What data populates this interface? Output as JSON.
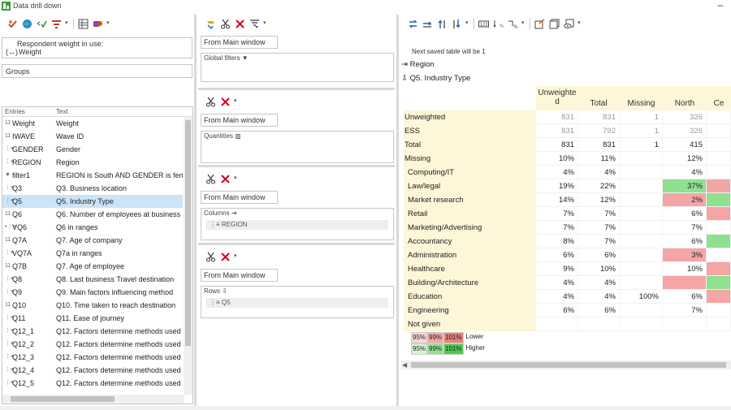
{
  "window": {
    "title": "Data drill down",
    "minimize_glyph": "–"
  },
  "left": {
    "weight_label": "Respondent weight in use:",
    "weight_value": "Weight",
    "weight_prefix": "(↔)",
    "groups_label": "Groups",
    "list_headers": {
      "entries": "Entries",
      "text": "Text"
    },
    "rows": [
      {
        "icon": "11",
        "entry": "Weight",
        "text": "Weight",
        "selected": false
      },
      {
        "icon": "11",
        "entry": "IWAVE",
        "text": "Wave ID",
        "selected": false
      },
      {
        "icon": "⋮≡",
        "entry": "GENDER",
        "text": "Gender",
        "selected": false
      },
      {
        "icon": "⋮≡",
        "entry": "REGION",
        "text": "Region",
        "selected": false
      },
      {
        "icon": "▼",
        "entry": "filter1",
        "text": "REGION is South AND GENDER is fem",
        "selected": false
      },
      {
        "icon": "⋮≡",
        "entry": "Q3",
        "text": "Q3. Business location",
        "selected": false
      },
      {
        "icon": "⋮≡",
        "entry": "Q5",
        "text": "Q5. Industry Type",
        "selected": true
      },
      {
        "icon": "11",
        "entry": "Q6",
        "text": "Q6. Number of employees at business",
        "selected": false
      },
      {
        "icon": "•⋮≡",
        "entry": "VQ6",
        "text": "Q6 in ranges",
        "selected": false
      },
      {
        "icon": "11",
        "entry": "Q7A",
        "text": "Q7. Age of company",
        "selected": false
      },
      {
        "icon": "⋮≡",
        "entry": "VQ7A",
        "text": "Q7a in ranges",
        "selected": false
      },
      {
        "icon": "11",
        "entry": "Q7B",
        "text": "Q7. Age of employee",
        "selected": false
      },
      {
        "icon": "⋮≡",
        "entry": "Q8",
        "text": "Q8. Last business Travel destination",
        "selected": false
      },
      {
        "icon": "⋮≡",
        "entry": "Q9",
        "text": "Q9. Main factors influencing method",
        "selected": false
      },
      {
        "icon": "11",
        "entry": "Q10",
        "text": "Q10. Time taken to reach destination",
        "selected": false
      },
      {
        "icon": "⋮≡",
        "entry": "Q11",
        "text": "Q11. Ease of journey",
        "selected": false
      },
      {
        "icon": "⋮≡",
        "entry": "Q12_1",
        "text": "Q12. Factors determine methods used",
        "selected": false
      },
      {
        "icon": "⋮≡",
        "entry": "Q12_2",
        "text": "Q12. Factors determine methods used",
        "selected": false
      },
      {
        "icon": "⋮≡",
        "entry": "Q12_3",
        "text": "Q12. Factors determine methods used",
        "selected": false
      },
      {
        "icon": "⋮≡",
        "entry": "Q12_4",
        "text": "Q12. Factors determine methods used",
        "selected": false
      },
      {
        "icon": "⋮≡",
        "entry": "Q12_5",
        "text": "Q12. Factors determine methods used",
        "selected": false
      }
    ]
  },
  "middle": {
    "sections": [
      {
        "source": "From Main window",
        "zone_label": "Global filters",
        "zone_icon": "▼",
        "chip": ""
      },
      {
        "source": "From Main window",
        "zone_label": "Quantities",
        "zone_icon": "▥",
        "chip": ""
      },
      {
        "source": "From Main window",
        "zone_label": "Columns",
        "zone_icon": "⇥",
        "chip": "⋮≡ REGION"
      },
      {
        "source": "From Main window",
        "zone_label": "Rows",
        "zone_icon": "⇩",
        "chip": "⋮≡ Q5"
      }
    ]
  },
  "right": {
    "saved_note": "Next saved table will be 1",
    "col_var": "Region",
    "row_var": "Q5. Industry Type",
    "col_var_icon": "⇥",
    "row_var_icon": "⇩",
    "columns": [
      "Unweighted",
      "Total",
      "Missing",
      "North",
      "Ce"
    ],
    "rows": [
      {
        "label": "Unweighted",
        "indent": false,
        "vals": [
          "831",
          "831",
          "1",
          "326",
          ""
        ],
        "faint": true
      },
      {
        "label": "ESS",
        "indent": false,
        "vals": [
          "831",
          "792",
          "1",
          "326",
          ""
        ],
        "faint": true
      },
      {
        "label": "Total",
        "indent": false,
        "vals": [
          "831",
          "831",
          "1",
          "415",
          ""
        ],
        "faint": false
      },
      {
        "label": "Missing",
        "indent": false,
        "vals": [
          "10%",
          "11%",
          "",
          "12%",
          ""
        ],
        "faint": false
      },
      {
        "label": "Computing/IT",
        "indent": true,
        "vals": [
          "4%",
          "4%",
          "",
          "4%",
          ""
        ],
        "faint": false
      },
      {
        "label": "Law/legal",
        "indent": true,
        "vals": [
          "19%",
          "22%",
          "",
          "37%",
          ""
        ],
        "faint": false,
        "hl": [
          null,
          null,
          null,
          "green",
          "red"
        ]
      },
      {
        "label": "Market research",
        "indent": true,
        "vals": [
          "14%",
          "12%",
          "",
          "2%",
          ""
        ],
        "faint": false,
        "hl": [
          null,
          null,
          null,
          "red",
          "green"
        ]
      },
      {
        "label": "Retail",
        "indent": true,
        "vals": [
          "7%",
          "7%",
          "",
          "6%",
          ""
        ],
        "faint": false,
        "hl": [
          null,
          null,
          null,
          null,
          "red"
        ]
      },
      {
        "label": "Marketing/Advertising",
        "indent": true,
        "vals": [
          "7%",
          "7%",
          "",
          "7%",
          ""
        ],
        "faint": false
      },
      {
        "label": "Accountancy",
        "indent": true,
        "vals": [
          "8%",
          "7%",
          "",
          "6%",
          ""
        ],
        "faint": false,
        "hl": [
          null,
          null,
          null,
          null,
          "green"
        ]
      },
      {
        "label": "Administration",
        "indent": true,
        "vals": [
          "6%",
          "6%",
          "",
          "3%",
          ""
        ],
        "faint": false,
        "hl": [
          null,
          null,
          null,
          "red",
          null
        ]
      },
      {
        "label": "Healthcare",
        "indent": true,
        "vals": [
          "9%",
          "10%",
          "",
          "10%",
          ""
        ],
        "faint": false,
        "hl": [
          null,
          null,
          null,
          null,
          "red"
        ]
      },
      {
        "label": "Building/Architecture",
        "indent": true,
        "vals": [
          "4%",
          "4%",
          "",
          "",
          ""
        ],
        "faint": false,
        "hl": [
          null,
          null,
          null,
          "red",
          "green"
        ]
      },
      {
        "label": "Education",
        "indent": true,
        "vals": [
          "4%",
          "4%",
          "100%",
          "6%",
          ""
        ],
        "faint": false,
        "hl": [
          null,
          null,
          null,
          null,
          "red"
        ]
      },
      {
        "label": "Engineering",
        "indent": true,
        "vals": [
          "6%",
          "6%",
          "",
          "7%",
          ""
        ],
        "faint": false
      },
      {
        "label": "Not given",
        "indent": true,
        "vals": [
          "",
          "",
          "",
          "",
          ""
        ],
        "faint": false
      }
    ],
    "legend_lower": {
      "cells": [
        "95%",
        "99%",
        "101%"
      ],
      "label": "Lower"
    },
    "legend_higher": {
      "cells": [
        "95%",
        "99%",
        "101%"
      ],
      "label": "Higher"
    },
    "colors": {
      "header_bg": "#fdf6d8",
      "red": "#f4a6a6",
      "green": "#8fe08f",
      "selection": "#cce4f7"
    }
  }
}
